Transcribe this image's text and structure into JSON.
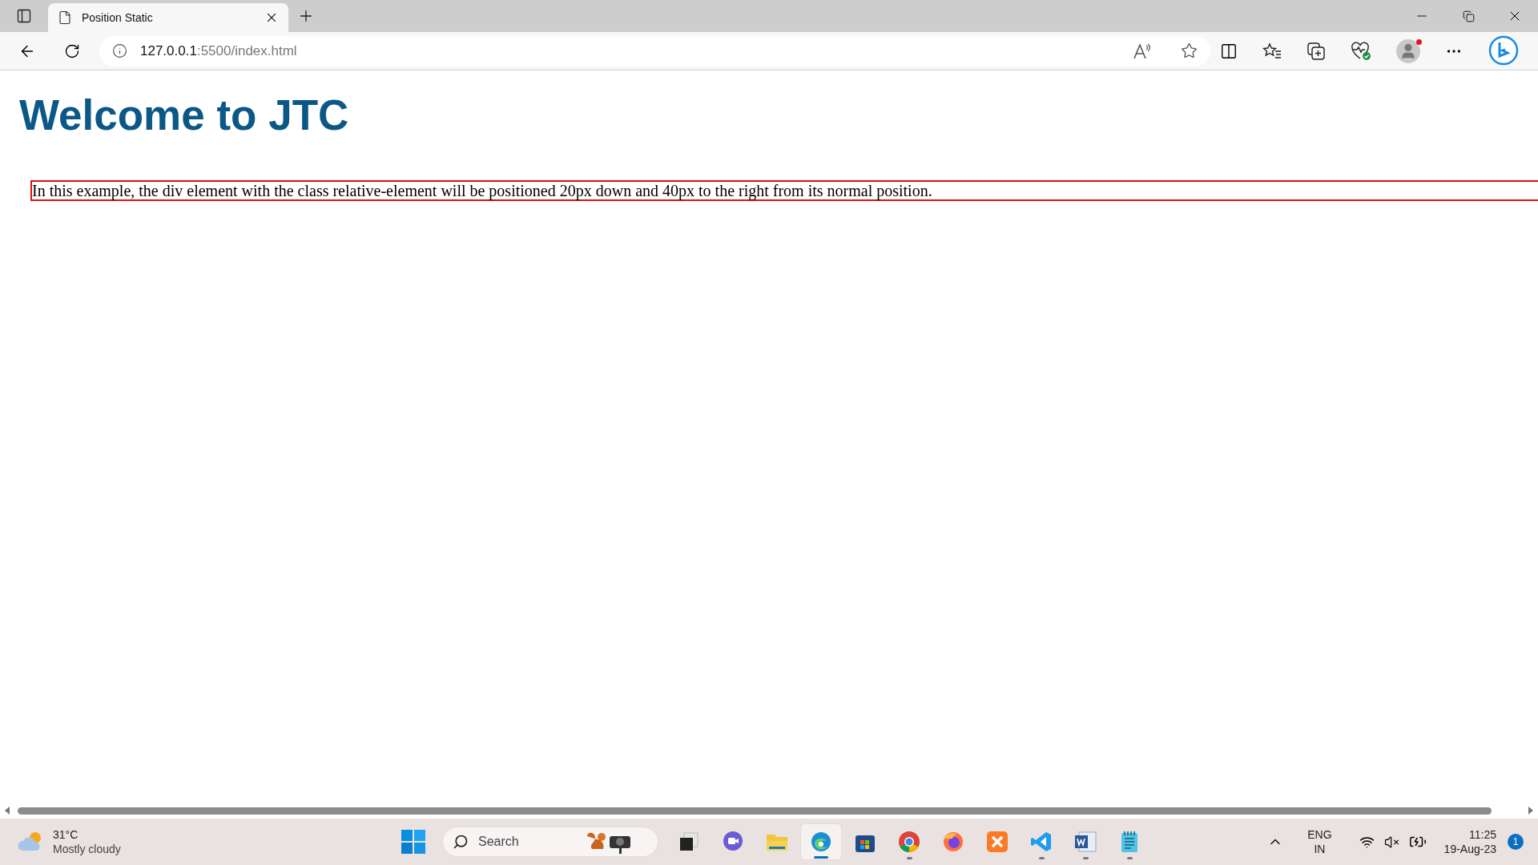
{
  "browser": {
    "tab": {
      "title": "Position Static",
      "selected": true
    },
    "address": {
      "host": "127.0.0.1",
      "rest": ":5500/index.html"
    }
  },
  "page": {
    "heading": "Welcome to JTC",
    "paragraph": "In this example, the div element with the class relative-element will be positioned 20px down and 40px to the right from its normal position."
  },
  "taskbar": {
    "weather": {
      "temperature": "31°C",
      "condition": "Mostly cloudy"
    },
    "search": {
      "placeholder": "Search"
    },
    "apps": [
      {
        "kind": "taskview",
        "running": false,
        "selected": false
      },
      {
        "kind": "chat",
        "running": false,
        "selected": false
      },
      {
        "kind": "folder",
        "running": false,
        "selected": false
      },
      {
        "kind": "edge",
        "running": true,
        "selected": true
      },
      {
        "kind": "store",
        "running": false,
        "selected": false
      },
      {
        "kind": "chrome",
        "running": true,
        "selected": false
      },
      {
        "kind": "firefox",
        "running": false,
        "selected": false
      },
      {
        "kind": "xampp",
        "running": false,
        "selected": false
      },
      {
        "kind": "vscode",
        "running": true,
        "selected": false
      },
      {
        "kind": "word",
        "running": true,
        "selected": false
      },
      {
        "kind": "notepad",
        "running": true,
        "selected": false
      }
    ],
    "language": {
      "line1": "ENG",
      "line2": "IN"
    },
    "clock": {
      "time": "11:25",
      "date": "19-Aug-23"
    },
    "notifications": "1"
  }
}
